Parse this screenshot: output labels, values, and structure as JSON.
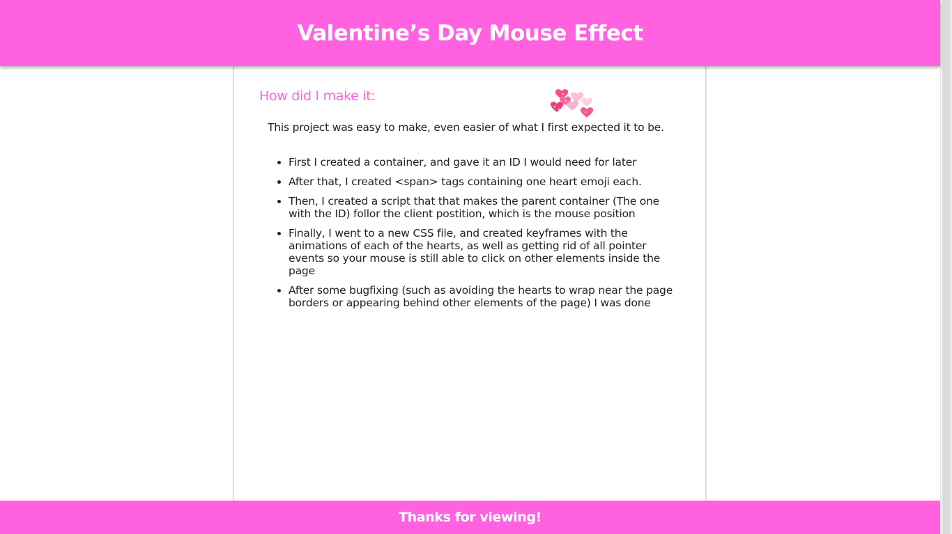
{
  "header": {
    "title": "Valentine’s Day Mouse Effect"
  },
  "main": {
    "heading": "How did I make it:",
    "intro": "This project was easy to make, even easier of what I first expected it to be.",
    "steps": [
      "First I created a container, and gave it an ID I would need for later",
      "After that, I created <span> tags containing one heart emoji each.",
      "Then, I created a script that that makes the parent container (The one with the ID) follor the client postition, which is the mouse position",
      "Finally, I went to a new CSS file, and created keyframes with the animations of each of the hearts, as well as getting rid of all pointer events so your mouse is still able to click on other elements inside the page",
      "After some bugfixing (such as avoiding the hearts to wrap near the page borders or appearing behind other elements of the page) I was done"
    ],
    "decoration_icon": "hearts-cluster-icon"
  },
  "footer": {
    "text": "Thanks for viewing!"
  },
  "colors": {
    "accent": "#ff61e0",
    "heart_dark": "#f04b8a",
    "heart_light": "#f7b3cc"
  }
}
